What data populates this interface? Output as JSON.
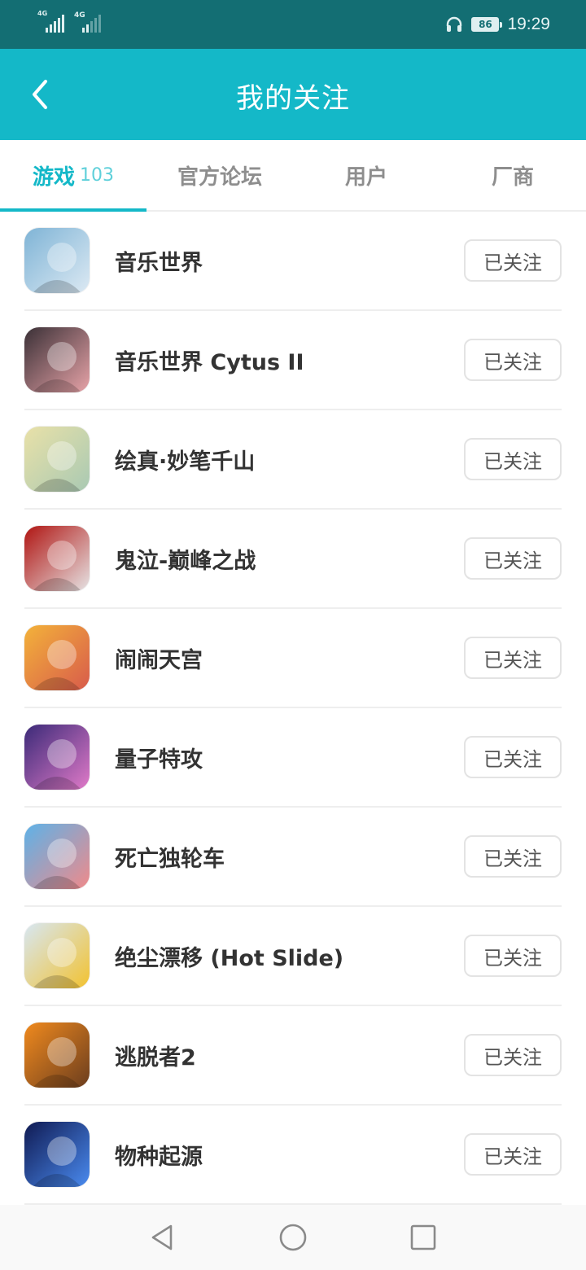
{
  "status_bar": {
    "network_1": "4G",
    "network_2": "4G",
    "battery": "86",
    "time": "19:29"
  },
  "header": {
    "title": "我的关注"
  },
  "tabs": [
    {
      "label": "游戏",
      "count": "103",
      "active": true
    },
    {
      "label": "官方论坛",
      "count": "",
      "active": false
    },
    {
      "label": "用户",
      "count": "",
      "active": false
    },
    {
      "label": "厂商",
      "count": "",
      "active": false
    }
  ],
  "follow_label": "已关注",
  "games": [
    {
      "name": "音乐世界",
      "icon": "icon-music-world",
      "colors": [
        "#7fb4d6",
        "#dce9f3"
      ]
    },
    {
      "name": "音乐世界 Cytus II",
      "icon": "icon-cytus-ii",
      "colors": [
        "#3a3036",
        "#e7a3a8"
      ]
    },
    {
      "name": "绘真·妙笔千山",
      "icon": "icon-painting",
      "colors": [
        "#e9e1a8",
        "#a9c9b3"
      ]
    },
    {
      "name": "鬼泣-巅峰之战",
      "icon": "icon-devil-may-cry",
      "colors": [
        "#b01512",
        "#e6e3e4"
      ]
    },
    {
      "name": "闹闹天宫",
      "icon": "icon-monkey-king",
      "colors": [
        "#f3b23a",
        "#d85b4b"
      ]
    },
    {
      "name": "量子特攻",
      "icon": "icon-quantum",
      "colors": [
        "#3b2a78",
        "#e07ac8"
      ]
    },
    {
      "name": "死亡独轮车",
      "icon": "icon-unicycle",
      "colors": [
        "#5db2e8",
        "#f08a8a"
      ]
    },
    {
      "name": "绝尘漂移 (Hot Slide)",
      "icon": "icon-race-car",
      "colors": [
        "#d7e7f3",
        "#f2c230"
      ]
    },
    {
      "name": "逃脱者2",
      "icon": "icon-escapists",
      "colors": [
        "#f08a1e",
        "#6b3d1e"
      ]
    },
    {
      "name": "物种起源",
      "icon": "icon-dna",
      "colors": [
        "#101a52",
        "#4a8bf0"
      ]
    }
  ]
}
